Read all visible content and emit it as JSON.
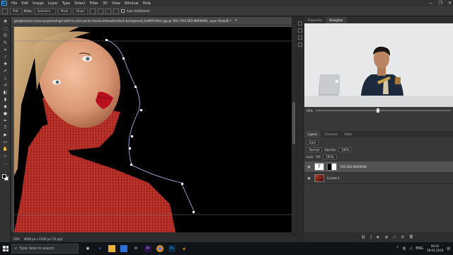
{
  "app": {
    "logo_text": "Ps",
    "menu": [
      "File",
      "Edit",
      "Image",
      "Layer",
      "Type",
      "Select",
      "Filter",
      "3D",
      "View",
      "Window",
      "Help"
    ],
    "window_controls": [
      "—",
      "❐",
      "✕"
    ]
  },
  "options_bar": {
    "tool_preset": "Path",
    "make_label": "Make:",
    "selection_btn": "Selection...",
    "mask_btn": "Mask",
    "shape_btn": "Shape",
    "auto_add_delete": "Auto Add/Delete"
  },
  "document": {
    "tab_title": "gangbixstock-close-up-portrait-girl-with-tn-pink-paints-clouds-silhouette-black-background_HuMRYGdhm.jpg @ 50% (THE RED MERMAID, Layer Mask/8) *",
    "close_glyph": "✕"
  },
  "status": {
    "zoom": "50%",
    "doc_info": "4000 px x 2250 px (72 ppi)"
  },
  "tools": [
    {
      "name": "move-tool-icon",
      "glyph": "✥"
    },
    {
      "name": "marquee-tool-icon",
      "glyph": "⬚"
    },
    {
      "name": "lasso-tool-icon",
      "glyph": "ʘ"
    },
    {
      "name": "quick-select-tool-icon",
      "glyph": "✎"
    },
    {
      "name": "crop-tool-icon",
      "glyph": "⌗"
    },
    {
      "name": "eyedropper-tool-icon",
      "glyph": "⁄"
    },
    {
      "name": "healing-brush-icon",
      "glyph": "✚"
    },
    {
      "name": "brush-tool-icon",
      "glyph": "✐"
    },
    {
      "name": "clone-stamp-icon",
      "glyph": "⊥"
    },
    {
      "name": "history-brush-icon",
      "glyph": "↺"
    },
    {
      "name": "eraser-tool-icon",
      "glyph": "◧"
    },
    {
      "name": "gradient-tool-icon",
      "glyph": "▮"
    },
    {
      "name": "blur-tool-icon",
      "glyph": "◆"
    },
    {
      "name": "dodge-tool-icon",
      "glyph": "●"
    },
    {
      "name": "pen-tool-icon",
      "glyph": "✒"
    },
    {
      "name": "type-tool-icon",
      "glyph": "T"
    },
    {
      "name": "path-select-tool-icon",
      "glyph": "▶"
    },
    {
      "name": "rectangle-tool-icon",
      "glyph": "▭"
    },
    {
      "name": "hand-tool-icon",
      "glyph": "✋"
    },
    {
      "name": "zoom-tool-icon",
      "glyph": "⌕"
    },
    {
      "name": "more-tools-icon",
      "glyph": "…"
    }
  ],
  "panels": {
    "top_tabs": [
      "Properties",
      "Navigator"
    ],
    "nav_zoom": "50%",
    "mid_tabs": [
      "Layers",
      "Channels",
      "Paths"
    ],
    "blend_mode": "Normal",
    "opacity_label": "Opacity:",
    "opacity_value": "100%",
    "lock_label": "Lock:",
    "fill_label": "Fill:",
    "fill_value": "100%",
    "kind_label": "Kind",
    "layers": [
      {
        "name": "THE RED MERMAID",
        "selected": true,
        "type": "text"
      },
      {
        "name": "Curves 1",
        "selected": false,
        "type": "image"
      }
    ],
    "footer_icons": [
      "link-icon",
      "fx-icon",
      "mask-icon",
      "adjustment-icon",
      "folder-icon",
      "new-layer-icon",
      "trash-icon"
    ]
  },
  "taskbar": {
    "search_placeholder": "Type here to search",
    "apps": [
      "task-view-icon",
      "edge-icon",
      "explorer-icon",
      "store-icon",
      "mail-icon",
      "premiere-icon",
      "chrome-icon",
      "photoshop-icon",
      "vlc-icon"
    ],
    "language": "ENG",
    "time": "09:02",
    "date": "28-01-2018"
  },
  "colors": {
    "accent_blue": "#31a8ff",
    "canvas_bg": "#000000",
    "glitter_red": "#a8241f"
  }
}
